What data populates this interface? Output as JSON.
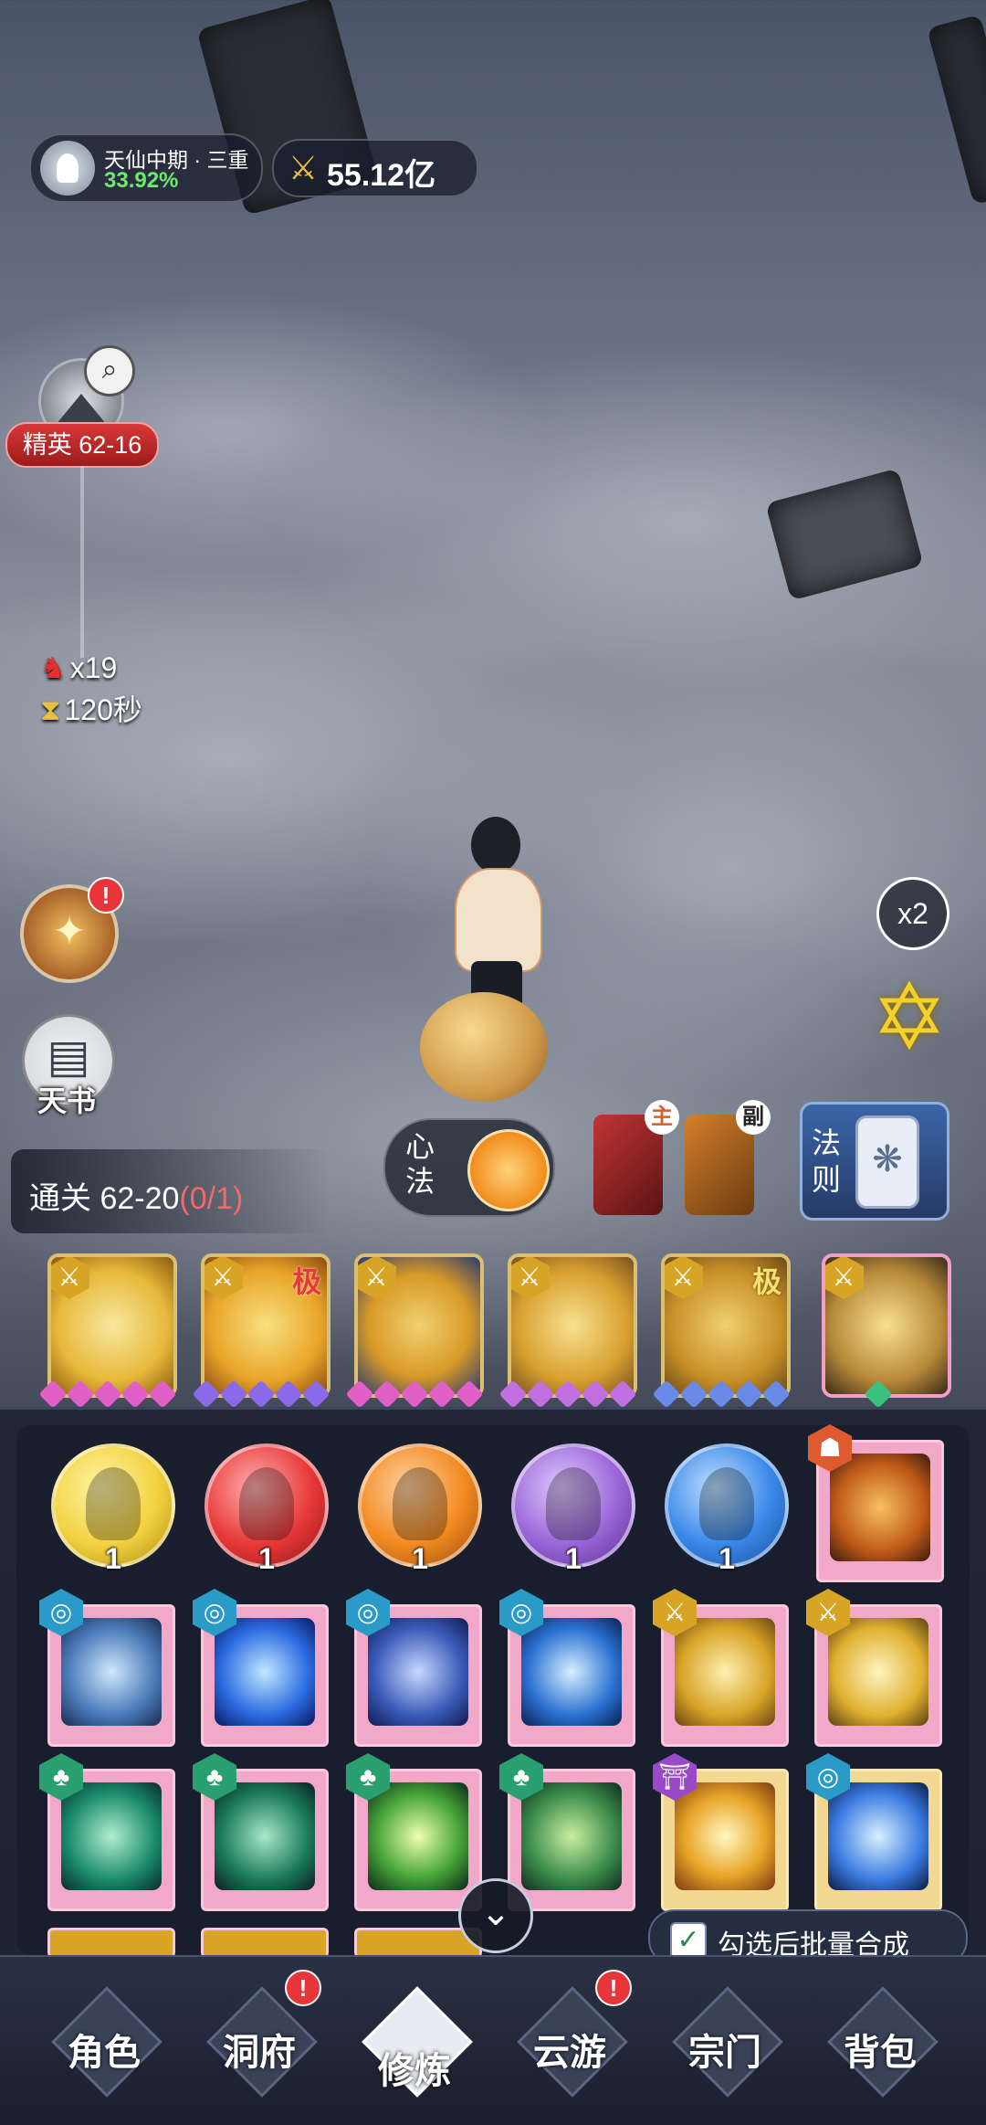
{
  "realm": {
    "name": "天仙中期 · 三重",
    "progress": "33.92%"
  },
  "power": {
    "value": "55.12亿"
  },
  "stage": {
    "label": "精英 62-16"
  },
  "battle": {
    "kills": "x19",
    "time": "120秒"
  },
  "buttons": {
    "book": "天书",
    "speed": "x2"
  },
  "xinfa": {
    "label": "心法"
  },
  "weapons": {
    "main": "主",
    "sub": "副"
  },
  "fase": {
    "label": "法则"
  },
  "clear": {
    "prefix": "通关 62-20",
    "count": "(0/1)"
  },
  "skills": [
    {
      "elem": "金",
      "tag": "",
      "art": "#e7b83a"
    },
    {
      "elem": "金",
      "tag": "极",
      "art": "#e9a52a"
    },
    {
      "elem": "金",
      "tag": "",
      "art": "#d99a28"
    },
    {
      "elem": "金",
      "tag": "",
      "art": "#d8a030"
    },
    {
      "elem": "金",
      "tag": "极",
      "art": "#c89028"
    },
    {
      "elem": "金",
      "tag": "",
      "art": "#b88a3a"
    }
  ],
  "orbs": [
    {
      "count": "1",
      "color": "#f2d240"
    },
    {
      "count": "1",
      "color": "#e83838"
    },
    {
      "count": "1",
      "color": "#f28a20"
    },
    {
      "count": "1",
      "color": "#9a66d8"
    },
    {
      "count": "1",
      "color": "#3a88e8"
    }
  ],
  "bottom_bar": {
    "batch_label": "勾选后批量合成"
  },
  "nav": [
    {
      "label": "角色"
    },
    {
      "label": "洞府"
    },
    {
      "label": "修炼"
    },
    {
      "label": "云游"
    },
    {
      "label": "宗门"
    },
    {
      "label": "背包"
    }
  ]
}
